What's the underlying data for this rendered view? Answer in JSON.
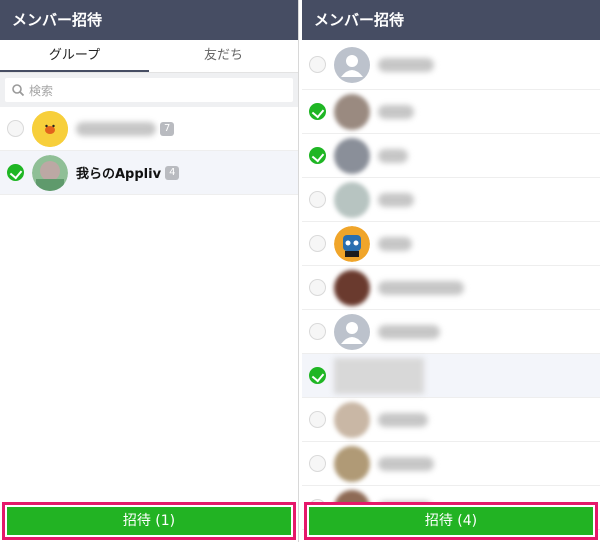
{
  "left": {
    "title": "メンバー招待",
    "tabs": [
      {
        "label": "グループ",
        "active": true
      },
      {
        "label": "友だち",
        "active": false
      }
    ],
    "search": {
      "placeholder": "検索"
    },
    "groups": [
      {
        "name_visible": false,
        "count": "7",
        "selected": false
      },
      {
        "name": "我らのAppliv",
        "count": "4",
        "selected": true
      }
    ],
    "invite_label": "招待 (1)"
  },
  "right": {
    "title": "メンバー招待",
    "friends_selected": [
      false,
      true,
      true,
      false,
      false,
      false,
      false,
      true,
      false,
      false,
      false
    ],
    "invite_label": "招待 (4)"
  },
  "colors": {
    "header_bg": "#464d63",
    "check_green": "#1fb624",
    "button_green": "#22b323",
    "highlight_border": "#e5186a"
  }
}
